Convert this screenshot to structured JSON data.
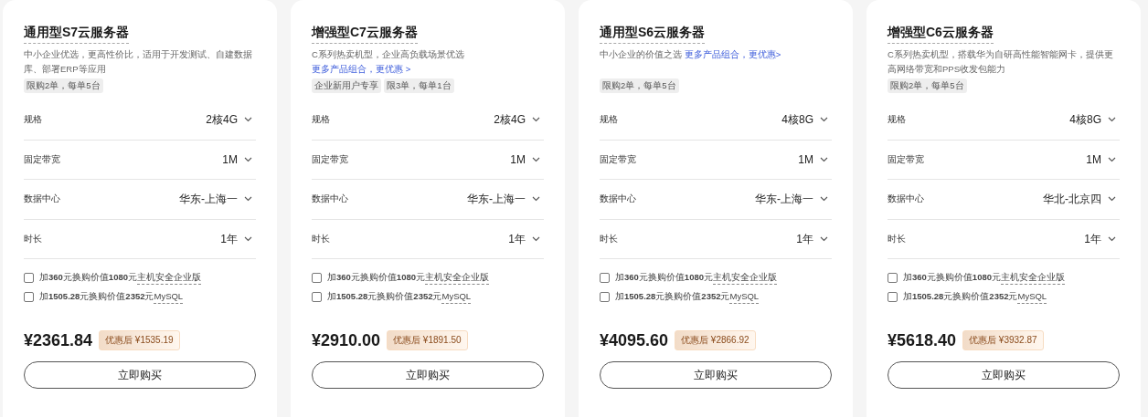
{
  "cards": [
    {
      "title": "通用型S7云服务器",
      "description": "中小企业优选，更高性价比，适用于开发测试、自建数据库、部署ERP等应用",
      "tags": [
        "限购2单，每单5台"
      ],
      "specs": [
        {
          "label": "规格",
          "value": "2核4G"
        },
        {
          "label": "固定带宽",
          "value": "1M"
        },
        {
          "label": "数据中心",
          "value": "华东-上海一"
        },
        {
          "label": "时长",
          "value": "1年"
        }
      ],
      "addons": [
        {
          "text": "加**360**元换购价值**1080**元",
          "product": "主机安全企业版",
          "checked": false
        },
        {
          "text": "加**1505.28**元换购价值**2352**元",
          "product": "MySQL",
          "checked": false
        }
      ],
      "price": "¥2361.84",
      "discount": "优惠后 ¥1535.19",
      "button": "立即购买"
    },
    {
      "title": "增强型C7云服务器",
      "description": "C系列热卖机型，企业高负载场景优选",
      "link": "更多产品组合，更优惠 >",
      "tags": [
        "企业新用户专享",
        "限3单，每单1台"
      ],
      "specs": [
        {
          "label": "规格",
          "value": "2核4G"
        },
        {
          "label": "固定带宽",
          "value": "1M"
        },
        {
          "label": "数据中心",
          "value": "华东-上海一"
        },
        {
          "label": "时长",
          "value": "1年"
        }
      ],
      "addons": [
        {
          "text": "加**360**元换购价值**1080**元",
          "product": "主机安全企业版",
          "checked": false
        },
        {
          "text": "加**1505.28**元换购价值**2352**元",
          "product": "MySQL",
          "checked": false
        }
      ],
      "price": "¥2910.00",
      "discount": "优惠后 ¥1891.50",
      "button": "立即购买"
    },
    {
      "title": "通用型S6云服务器",
      "description": "中小企业的价值之选",
      "link": "更多产品组合，更优惠>",
      "tags": [
        "限购2单，每单5台"
      ],
      "specs": [
        {
          "label": "规格",
          "value": "4核8G"
        },
        {
          "label": "固定带宽",
          "value": "1M"
        },
        {
          "label": "数据中心",
          "value": "华东-上海一"
        },
        {
          "label": "时长",
          "value": "1年"
        }
      ],
      "addons": [
        {
          "text": "加**360**元换购价值**1080**元",
          "product": "主机安全企业版",
          "checked": false
        },
        {
          "text": "加**1505.28**元换购价值**2352**元",
          "product": "MySQL",
          "checked": false
        }
      ],
      "price": "¥4095.60",
      "discount": "优惠后 ¥2866.92",
      "button": "立即购买"
    },
    {
      "title": "增强型C6云服务器",
      "description": "C系列热卖机型，搭载华为自研高性能智能网卡，提供更高网络带宽和PPS收发包能力",
      "tags": [
        "限购2单，每单5台"
      ],
      "specs": [
        {
          "label": "规格",
          "value": "4核8G"
        },
        {
          "label": "固定带宽",
          "value": "1M"
        },
        {
          "label": "数据中心",
          "value": "华北-北京四"
        },
        {
          "label": "时长",
          "value": "1年"
        }
      ],
      "addons": [
        {
          "text": "加**360**元换购价值**1080**元",
          "product": "主机安全企业版",
          "checked": false
        },
        {
          "text": "加**1505.28**元换购价值**2352**元",
          "product": "MySQL",
          "checked": false
        }
      ],
      "price": "¥5618.40",
      "discount": "优惠后 ¥3932.87",
      "button": "立即购买"
    }
  ]
}
